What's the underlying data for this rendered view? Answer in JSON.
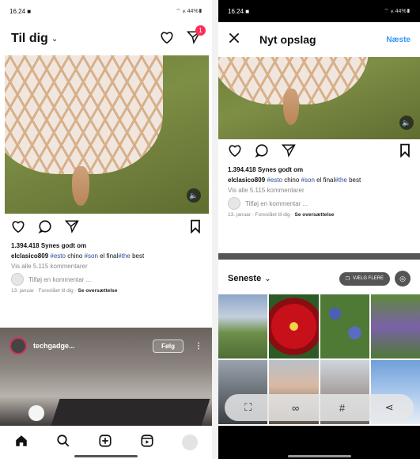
{
  "left": {
    "status": {
      "time": "16.24 ■",
      "right": "⌔ ⩚ 44%▮"
    },
    "header": {
      "title": "Til dig",
      "notification_count": "1"
    },
    "post1": {
      "likes": "1.394.418 Synes godt om",
      "caption_user": "elclasico809",
      "caption_parts": [
        "#esto",
        " chino ",
        "#son",
        " el final",
        "#the",
        " best"
      ],
      "view_comments": "Vis alle 5.115 kommentarer",
      "add_comment_placeholder": "Tilføj en kommentar ...",
      "date_line": "13. januar · Foreslået til dig · ",
      "translate": "Se oversættelse"
    },
    "post2": {
      "username": "techgadge...",
      "follow": "Følg"
    }
  },
  "right": {
    "status": {
      "time": "16.24 ■",
      "right": "⌔ ⩚ 44%▮"
    },
    "header": {
      "title": "Nyt opslag",
      "next": "Næste"
    },
    "preview": {
      "likes": "1.394.418 Synes godt om",
      "caption_user": "elclasico809",
      "caption_parts": [
        "#esto",
        " chino ",
        "#son",
        " el final",
        "#the",
        " best"
      ],
      "view_comments": "Vis alle 5.115 kommentarer",
      "add_comment_placeholder": "Tilføj en kommentar ...",
      "date_line": "13. januar · Foreslået til dig · ",
      "translate": "Se oversættelse"
    },
    "gallery": {
      "title": "Seneste",
      "select_multiple": "VÆLG FLERE"
    }
  },
  "colors": {
    "link_blue": "#3797f0",
    "badge_red": "#ff2d55",
    "hashtag": "#2b4a9c"
  }
}
